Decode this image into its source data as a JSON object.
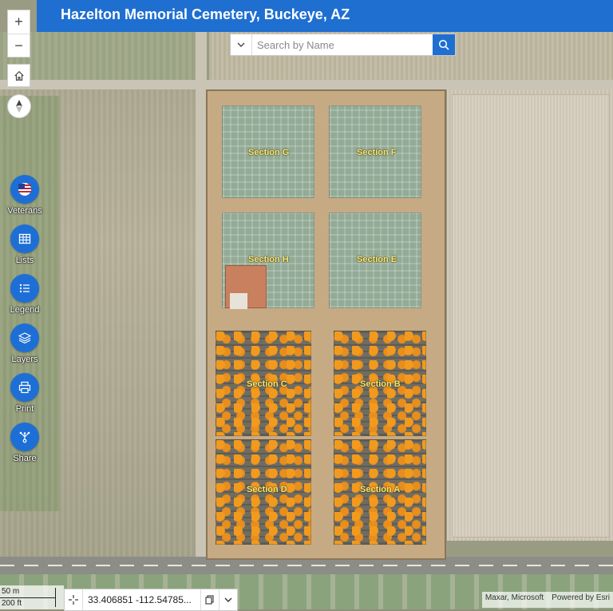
{
  "header": {
    "title": "Hazelton Memorial Cemetery, Buckeye, AZ"
  },
  "map_controls": {
    "zoom_in": "+",
    "zoom_out": "−"
  },
  "tools": [
    {
      "label": "Veterans",
      "icon": "us-flag-icon"
    },
    {
      "label": "Lists",
      "icon": "table-icon"
    },
    {
      "label": "Legend",
      "icon": "list-icon"
    },
    {
      "label": "Layers",
      "icon": "layers-icon"
    },
    {
      "label": "Print",
      "icon": "printer-icon"
    },
    {
      "label": "Share",
      "icon": "share-icon"
    }
  ],
  "search": {
    "placeholder": "Search by Name"
  },
  "sections": {
    "g": "Section G",
    "f": "Section F",
    "h": "Section H",
    "e": "Section E",
    "c": "Section C",
    "b": "Section B",
    "d": "Section D",
    "a": "Section A"
  },
  "scale": {
    "metric": "50 m",
    "imperial": "200 ft"
  },
  "coordinates": {
    "value": "33.406851 -112.54785..."
  },
  "attribution": {
    "sources": "Maxar, Microsoft",
    "powered": "Powered by Esri"
  },
  "colors": {
    "accent": "#1f6fd1",
    "tool_button": "#1d6fd6",
    "occupied_plot": "#f29a1e",
    "section_label": "#f5e67a"
  }
}
